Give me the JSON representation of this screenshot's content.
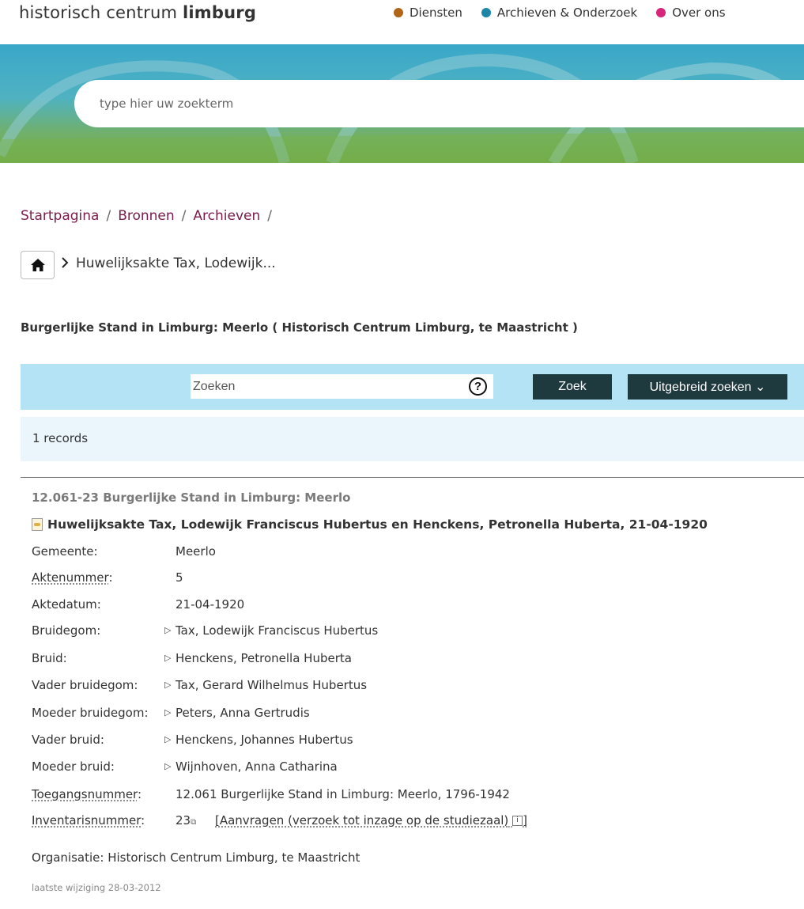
{
  "header": {
    "logo": {
      "part1": "historisch ",
      "part2": "centrum ",
      "part3": "limburg"
    },
    "nav": [
      {
        "label": "Diensten",
        "color": "#b06418"
      },
      {
        "label": "Archieven & Onderzoek",
        "color": "#1e86a6"
      },
      {
        "label": "Over ons",
        "color": "#d6257a"
      }
    ]
  },
  "hero": {
    "search_placeholder": "type hier uw zoekterm"
  },
  "breadcrumb": [
    "Startpagina",
    "Bronnen",
    "Archieven"
  ],
  "breadcrumb_sep": "/",
  "current_crumb": "Huwelijksakte Tax, Lodewijk...",
  "archive_title": "Burgerlijke Stand in Limburg: Meerlo ( Historisch Centrum Limburg, te Maastricht )",
  "search": {
    "placeholder": "Zoeken",
    "help": "?",
    "zoek_label": "Zoek",
    "advanced_label": "Uitgebreid zoeken ⌄"
  },
  "records_count": "1  records",
  "record": {
    "code": "12.061-23 Burgerlijke Stand in Limburg: Meerlo",
    "title": "Huwelijksakte Tax, Lodewijk Franciscus Hubertus en Henckens, Petronella Huberta, 21-04-1920",
    "fields": {
      "gemeente": {
        "label": "Gemeente:",
        "value": "Meerlo"
      },
      "aktenummer": {
        "label": "Aktenummer",
        "value": "5"
      },
      "aktedatum": {
        "label": "Aktedatum:",
        "value": "21-04-1920"
      },
      "bruidegom": {
        "label": "Bruidegom:",
        "value": "Tax, Lodewijk Franciscus Hubertus"
      },
      "bruid": {
        "label": "Bruid:",
        "value": "Henckens, Petronella Huberta"
      },
      "vader_bruidegom": {
        "label": "Vader bruidegom:",
        "value": "Tax, Gerard Wilhelmus Hubertus"
      },
      "moeder_bruidegom": {
        "label": "Moeder bruidegom:",
        "value": "Peters, Anna Gertrudis"
      },
      "vader_bruid": {
        "label": "Vader bruid:",
        "value": "Henckens, Johannes Hubertus"
      },
      "moeder_bruid": {
        "label": "Moeder bruid:",
        "value": "Wijnhoven, Anna Catharina"
      },
      "toegangsnummer": {
        "label": "Toegangsnummer",
        "value": "12.061 Burgerlijke Stand in Limburg: Meerlo, 1796-1942"
      },
      "inventarisnummer": {
        "label": "Inventarisnummer",
        "value": "23"
      }
    },
    "aanvragen": "[Aanvragen (verzoek tot inzage op de studiezaal)",
    "aanvragen_end": "]",
    "organisatie": "Organisatie: Historisch Centrum Limburg, te Maastricht",
    "laatste_wijziging": "laatste wijziging 28-03-2012"
  }
}
